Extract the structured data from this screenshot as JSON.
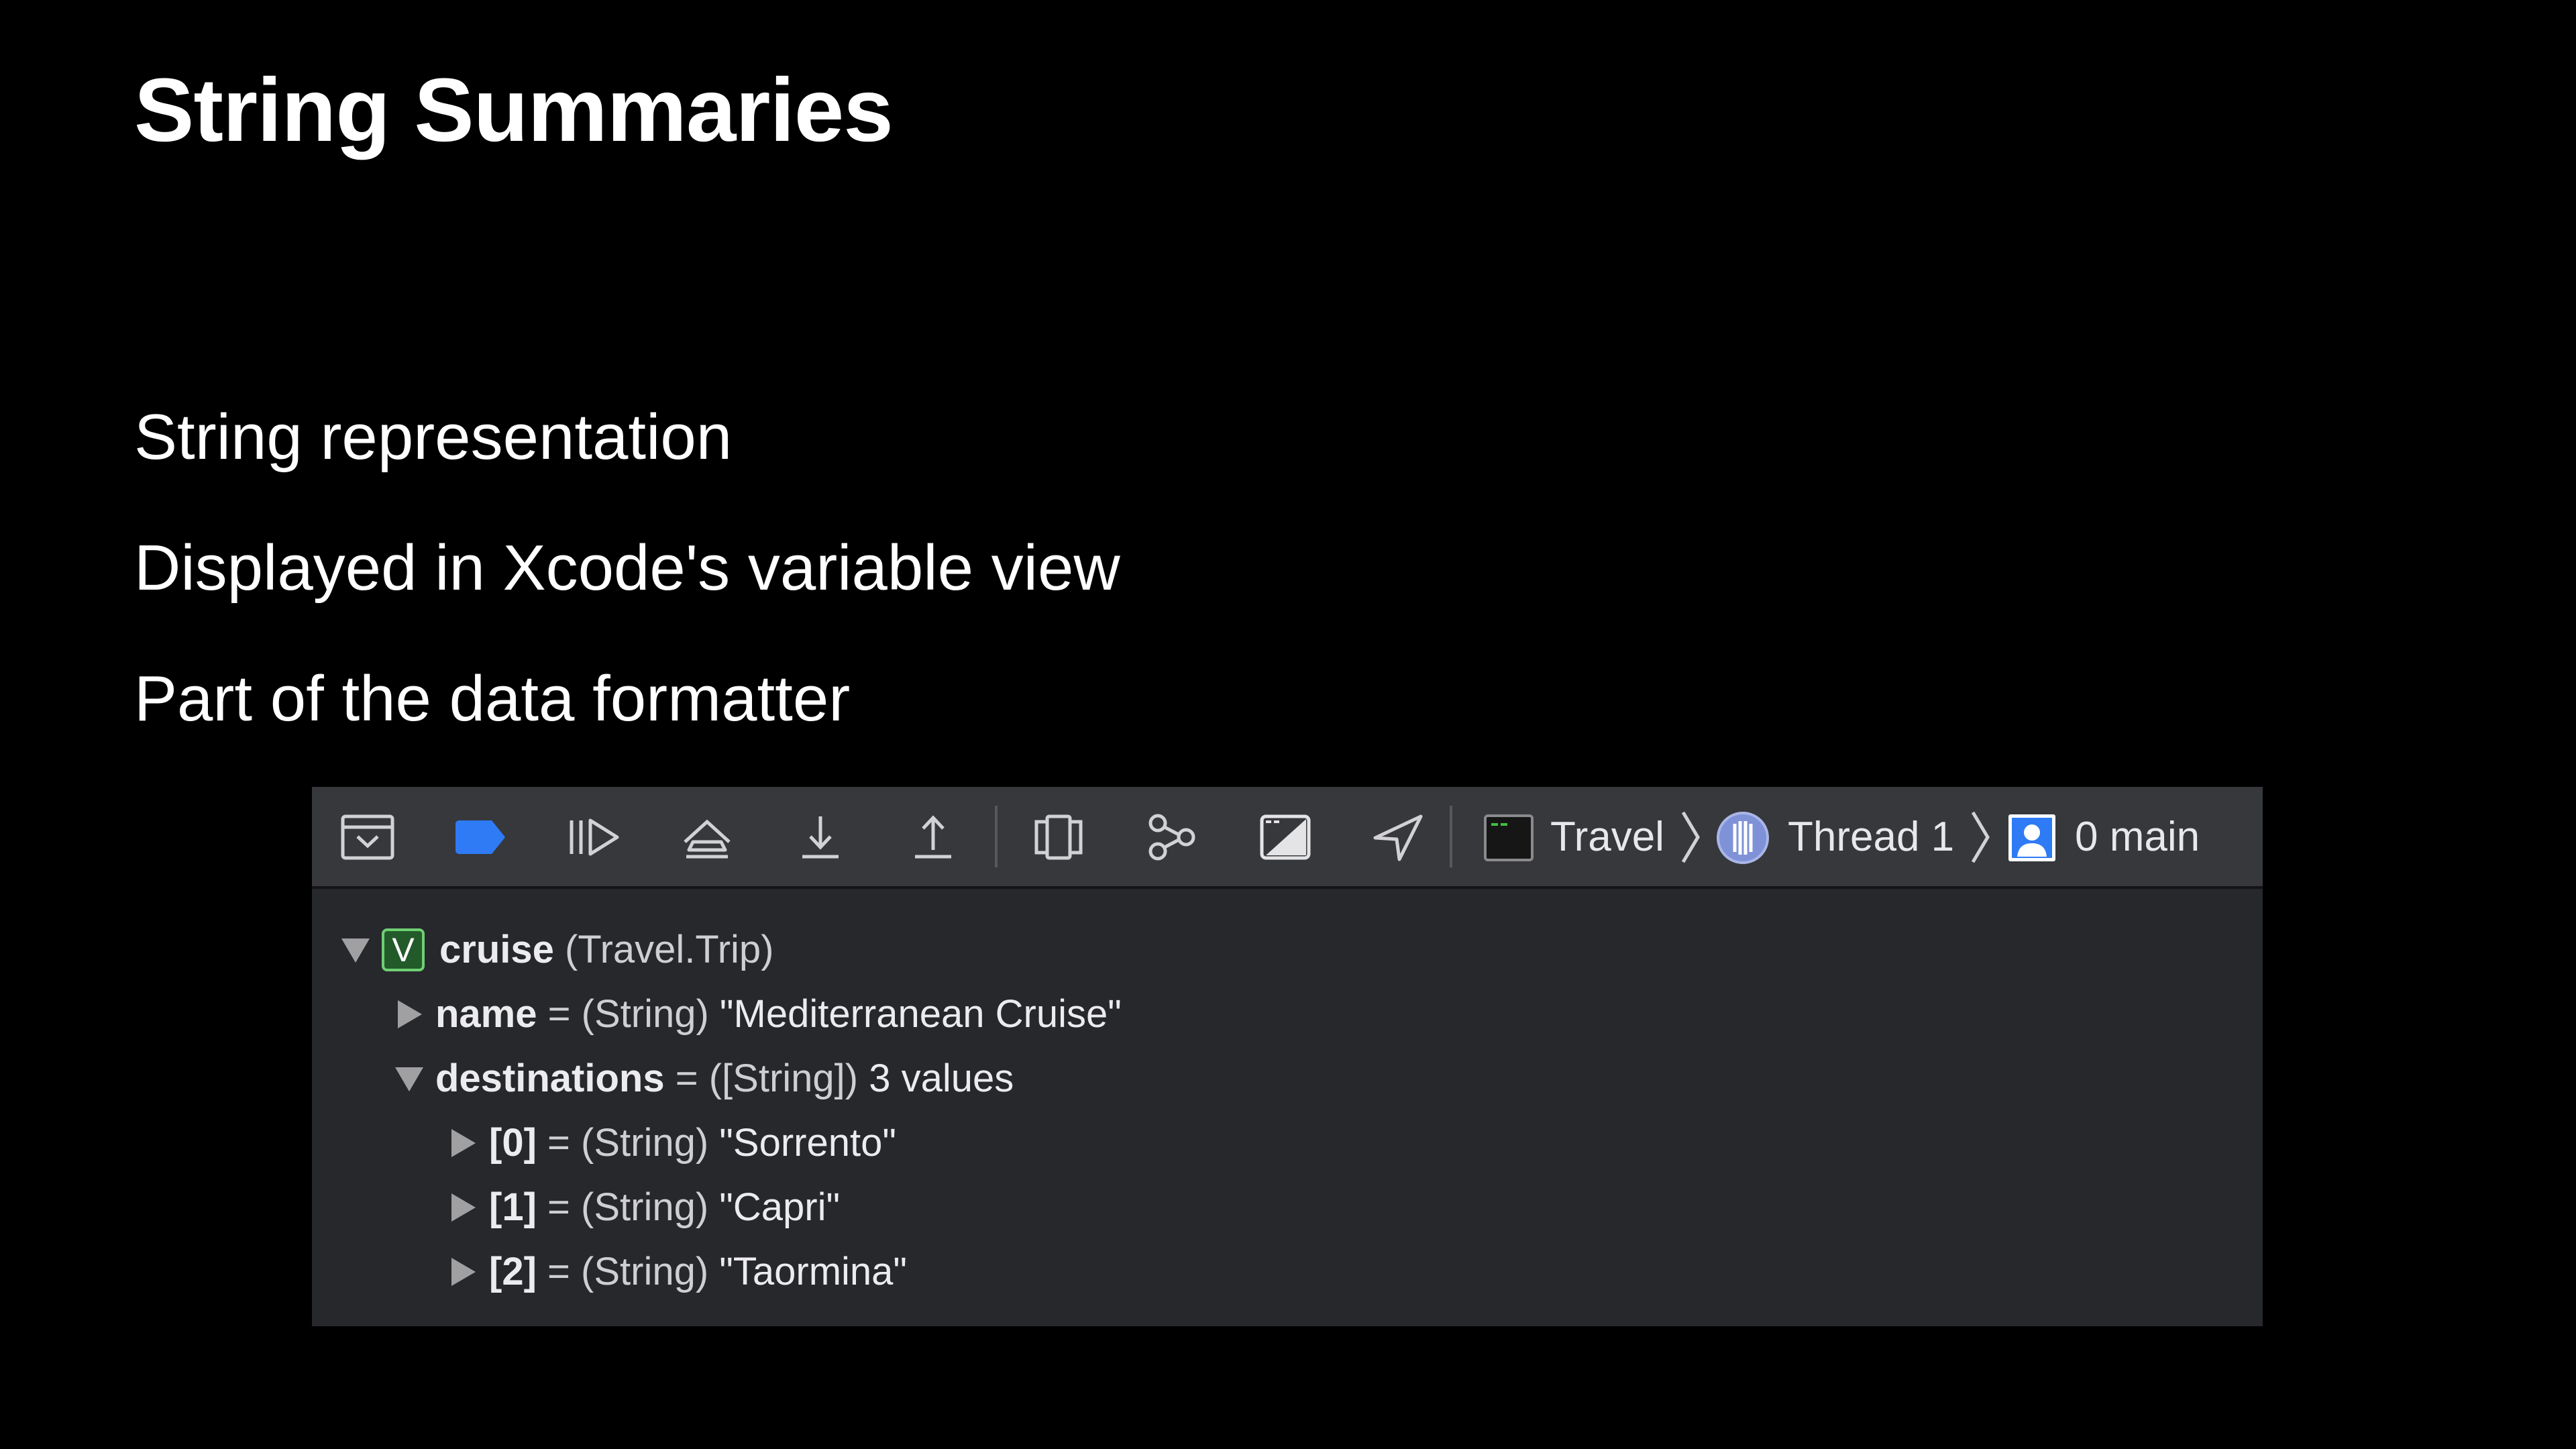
{
  "slide": {
    "title": "String Summaries",
    "bullets": [
      "String representation",
      "Displayed in Xcode's variable view",
      "Part of the data formatter"
    ]
  },
  "toolbar": {
    "icons": [
      "hide-debug-area-icon",
      "breakpoints-toggle-icon",
      "continue-icon",
      "step-over-icon",
      "step-into-icon",
      "step-out-icon",
      "debug-view-hierarchy-icon",
      "memory-graph-icon",
      "environment-overrides-icon",
      "simulate-location-icon"
    ],
    "breadcrumb": {
      "target": "Travel",
      "thread": "Thread 1",
      "frame": "0 main"
    },
    "accent_color": "#2f7bf6"
  },
  "variables": {
    "root": {
      "badge": "V",
      "name": "cruise",
      "type": "(Travel.Trip)"
    },
    "name_row": {
      "name": "name",
      "eq": "=",
      "type": "(String)",
      "value": "\"Mediterranean Cruise\""
    },
    "destinations_row": {
      "name": "destinations",
      "eq": "=",
      "type": "([String])",
      "value": "3 values"
    },
    "items": [
      {
        "name": "[0]",
        "eq": "=",
        "type": "(String)",
        "value": "\"Sorrento\""
      },
      {
        "name": "[1]",
        "eq": "=",
        "type": "(String)",
        "value": "\"Capri\""
      },
      {
        "name": "[2]",
        "eq": "=",
        "type": "(String)",
        "value": "\"Taormina\""
      }
    ]
  }
}
